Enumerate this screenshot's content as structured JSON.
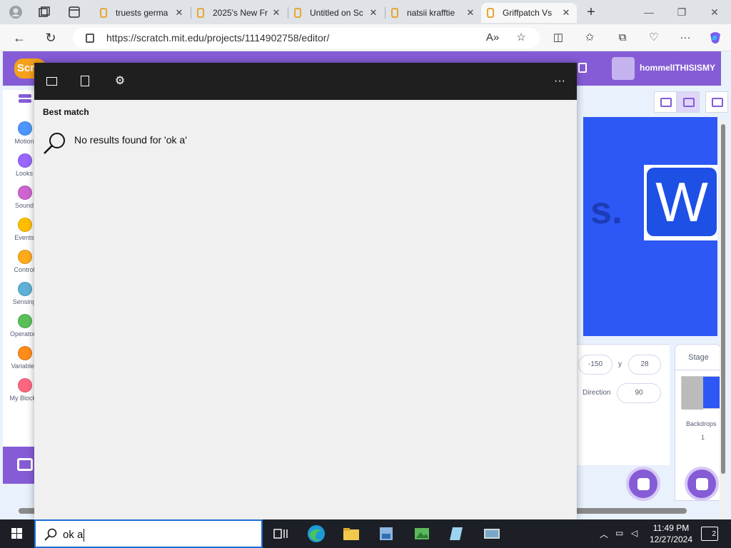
{
  "browser": {
    "tabs": [
      {
        "title": "truests germa"
      },
      {
        "title": "2025's New Fr"
      },
      {
        "title": "Untitled on Sc"
      },
      {
        "title": "natsii krafftie"
      },
      {
        "title": "Griffpatch Vs"
      }
    ],
    "url": "https://scratch.mit.edu/projects/1114902758/editor/",
    "new_tab": "+",
    "close": "✕"
  },
  "scratch": {
    "logo": "Scr",
    "username": "hommelITHISISMY",
    "categories": [
      {
        "label": "Motion",
        "color": "#4c97ff"
      },
      {
        "label": "Looks",
        "color": "#9966ff"
      },
      {
        "label": "Sound",
        "color": "#cf63cf"
      },
      {
        "label": "Events",
        "color": "#ffbf00"
      },
      {
        "label": "Control",
        "color": "#ffab19"
      },
      {
        "label": "Sensing",
        "color": "#5cb1d6"
      },
      {
        "label": "Operators",
        "color": "#59c059"
      },
      {
        "label": "Variables",
        "color": "#ff8c1a"
      },
      {
        "label": "My Blocks",
        "color": "#ff6680"
      }
    ],
    "stage_letter": "W",
    "stage_text": "s.",
    "sprite": {
      "x": "-150",
      "y_label": "y",
      "y": "28",
      "direction_label": "Direction",
      "direction": "90"
    },
    "stage_panel": {
      "title": "Stage",
      "backdrops_label": "Backdrops",
      "backdrops_count": "1"
    }
  },
  "search": {
    "best_match": "Best match",
    "no_results": "No results found for 'ok a'",
    "query": "ok a",
    "more": "···"
  },
  "taskbar": {
    "time": "11:49 PM",
    "date": "12/27/2024",
    "notifications": "2"
  }
}
